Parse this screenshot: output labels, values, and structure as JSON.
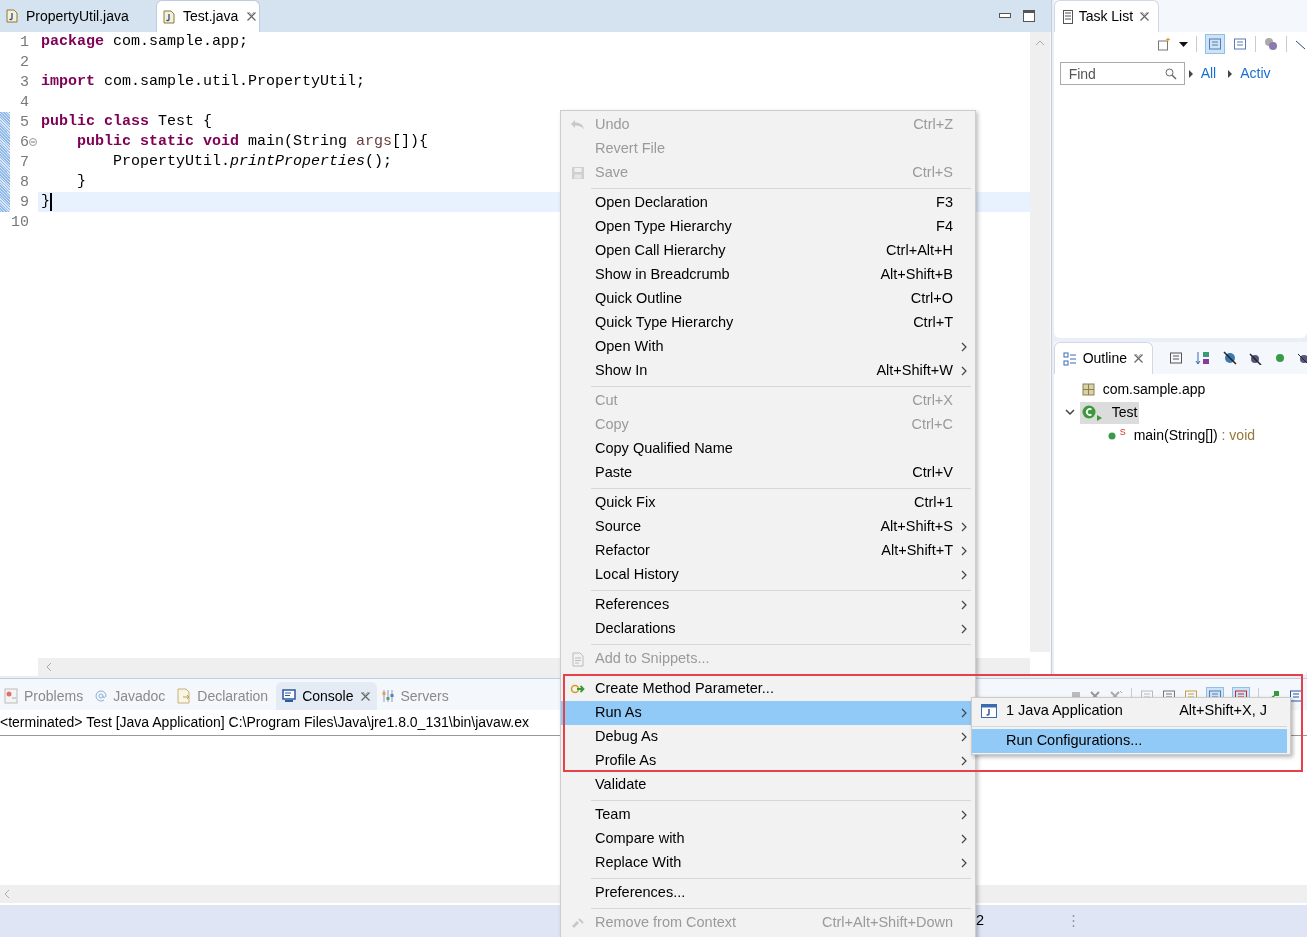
{
  "editor": {
    "tabs": [
      {
        "label": "PropertyUtil.java",
        "selected": false
      },
      {
        "label": "Test.java",
        "selected": true
      }
    ],
    "lines": [
      {
        "number": "1",
        "changed": false,
        "current": false,
        "fold": false,
        "tokens": [
          {
            "kind": "keyword",
            "text": "package"
          },
          {
            "kind": "plain",
            "text": " com.sample.app;"
          }
        ]
      },
      {
        "number": "2",
        "changed": false,
        "current": false,
        "fold": false
      },
      {
        "number": "3",
        "changed": false,
        "current": false,
        "fold": false,
        "tokens": [
          {
            "kind": "keyword",
            "text": "import"
          },
          {
            "kind": "plain",
            "text": " com.sample.util.PropertyUtil;"
          }
        ]
      },
      {
        "number": "4",
        "changed": false,
        "current": false,
        "fold": false
      },
      {
        "number": "5",
        "changed": true,
        "current": false,
        "fold": false,
        "tokens": [
          {
            "kind": "keyword",
            "text": "public class"
          },
          {
            "kind": "plain",
            "text": " Test {"
          }
        ]
      },
      {
        "number": "6",
        "changed": true,
        "current": false,
        "fold": true,
        "tokens": [
          {
            "kind": "keyword",
            "text": "    public static void"
          },
          {
            "kind": "plain",
            "text": " main(String "
          },
          {
            "kind": "variable",
            "text": "args"
          },
          {
            "kind": "plain",
            "text": "[]){"
          }
        ]
      },
      {
        "number": "7",
        "changed": true,
        "current": false,
        "fold": false,
        "tokens": [
          {
            "kind": "plain",
            "text": "        PropertyUtil."
          },
          {
            "kind": "static_call",
            "text": "printProperties"
          },
          {
            "kind": "plain",
            "text": "();"
          }
        ]
      },
      {
        "number": "8",
        "changed": true,
        "current": false,
        "fold": false,
        "tokens": [
          {
            "kind": "plain",
            "text": "    }"
          }
        ]
      },
      {
        "number": "9",
        "changed": true,
        "current": true,
        "fold": false,
        "tokens": [
          {
            "kind": "plain",
            "text": "}"
          }
        ]
      },
      {
        "number": "10",
        "changed": false,
        "current": false,
        "fold": false
      }
    ]
  },
  "task_list": {
    "title": "Task List",
    "find_placeholder": "Find",
    "filters": [
      "All",
      "Activ"
    ]
  },
  "outline": {
    "title": "Outline",
    "tree": [
      {
        "kind": "package",
        "label": "com.sample.app",
        "selected": false
      },
      {
        "kind": "class",
        "label": "Test",
        "selected": true,
        "expanded": true,
        "children": [
          {
            "kind": "method",
            "label": "main(String[])",
            "type": " : void",
            "badge": "S",
            "selected": false
          }
        ]
      }
    ]
  },
  "bottom_panel": {
    "tabs": [
      {
        "label": "Problems",
        "kind": "problems",
        "selected": false
      },
      {
        "label": "Javadoc",
        "kind": "javadoc",
        "selected": false
      },
      {
        "label": "Declaration",
        "kind": "declaration",
        "selected": false
      },
      {
        "label": "Console",
        "kind": "console",
        "selected": true
      },
      {
        "label": "Servers",
        "kind": "servers",
        "selected": false
      }
    ],
    "console_header": "<terminated> Test [Java Application] C:\\Program Files\\Java\\jre1.8.0_131\\bin\\javaw.ex"
  },
  "status_bar": {
    "text": "2"
  },
  "context_menu": {
    "groups": [
      [
        {
          "label": "Undo",
          "shortcut": "Ctrl+Z",
          "kind": "undo",
          "disabled": true,
          "submenu": false,
          "selected": false
        },
        {
          "label": "Revert File",
          "disabled": true,
          "submenu": false,
          "selected": false
        },
        {
          "label": "Save",
          "shortcut": "Ctrl+S",
          "kind": "save",
          "disabled": true,
          "submenu": false,
          "selected": false
        }
      ],
      [
        {
          "label": "Open Declaration",
          "shortcut": "F3",
          "disabled": false,
          "submenu": false,
          "selected": false
        },
        {
          "label": "Open Type Hierarchy",
          "shortcut": "F4",
          "disabled": false,
          "submenu": false,
          "selected": false
        },
        {
          "label": "Open Call Hierarchy",
          "shortcut": "Ctrl+Alt+H",
          "disabled": false,
          "submenu": false,
          "selected": false
        },
        {
          "label": "Show in Breadcrumb",
          "shortcut": "Alt+Shift+B",
          "disabled": false,
          "submenu": false,
          "selected": false
        },
        {
          "label": "Quick Outline",
          "shortcut": "Ctrl+O",
          "disabled": false,
          "submenu": false,
          "selected": false
        },
        {
          "label": "Quick Type Hierarchy",
          "shortcut": "Ctrl+T",
          "disabled": false,
          "submenu": false,
          "selected": false
        },
        {
          "label": "Open With",
          "disabled": false,
          "submenu": true,
          "selected": false
        },
        {
          "label": "Show In",
          "shortcut": "Alt+Shift+W",
          "disabled": false,
          "submenu": true,
          "selected": false
        }
      ],
      [
        {
          "label": "Cut",
          "shortcut": "Ctrl+X",
          "disabled": true,
          "submenu": false,
          "selected": false
        },
        {
          "label": "Copy",
          "shortcut": "Ctrl+C",
          "disabled": true,
          "submenu": false,
          "selected": false
        },
        {
          "label": "Copy Qualified Name",
          "disabled": false,
          "submenu": false,
          "selected": false
        },
        {
          "label": "Paste",
          "shortcut": "Ctrl+V",
          "disabled": false,
          "submenu": false,
          "selected": false
        }
      ],
      [
        {
          "label": "Quick Fix",
          "shortcut": "Ctrl+1",
          "disabled": false,
          "submenu": false,
          "selected": false
        },
        {
          "label": "Source",
          "shortcut": "Alt+Shift+S",
          "disabled": false,
          "submenu": true,
          "selected": false
        },
        {
          "label": "Refactor",
          "shortcut": "Alt+Shift+T",
          "disabled": false,
          "submenu": true,
          "selected": false
        },
        {
          "label": "Local History",
          "disabled": false,
          "submenu": true,
          "selected": false
        }
      ],
      [
        {
          "label": "References",
          "disabled": false,
          "submenu": true,
          "selected": false
        },
        {
          "label": "Declarations",
          "disabled": false,
          "submenu": true,
          "selected": false
        }
      ],
      [
        {
          "label": "Add to Snippets...",
          "kind": "snippet",
          "disabled": true,
          "submenu": false,
          "selected": false
        }
      ],
      [
        {
          "label": "Create Method Parameter...",
          "kind": "parameter",
          "disabled": false,
          "submenu": false,
          "selected": false
        },
        {
          "label": "Run As",
          "disabled": false,
          "submenu": true,
          "selected": true
        },
        {
          "label": "Debug As",
          "disabled": false,
          "submenu": true,
          "selected": false
        },
        {
          "label": "Profile As",
          "disabled": false,
          "submenu": true,
          "selected": false
        },
        {
          "label": "Validate",
          "disabled": false,
          "submenu": false,
          "selected": false
        }
      ],
      [
        {
          "label": "Team",
          "disabled": false,
          "submenu": true,
          "selected": false
        },
        {
          "label": "Compare with",
          "disabled": false,
          "submenu": true,
          "selected": false
        },
        {
          "label": "Replace With",
          "disabled": false,
          "submenu": true,
          "selected": false
        }
      ],
      [
        {
          "label": "Preferences...",
          "disabled": false,
          "submenu": false,
          "selected": false
        }
      ],
      [
        {
          "label": "Remove from Context",
          "shortcut": "Ctrl+Alt+Shift+Down",
          "kind": "remove",
          "disabled": true,
          "submenu": false,
          "selected": false
        }
      ]
    ]
  },
  "submenu": {
    "groups": [
      [
        {
          "label": "1 Java Application",
          "shortcut": "Alt+Shift+X, J",
          "kind": "java",
          "selected": false
        }
      ],
      [
        {
          "label": "Run Configurations...",
          "selected": true
        }
      ]
    ]
  }
}
